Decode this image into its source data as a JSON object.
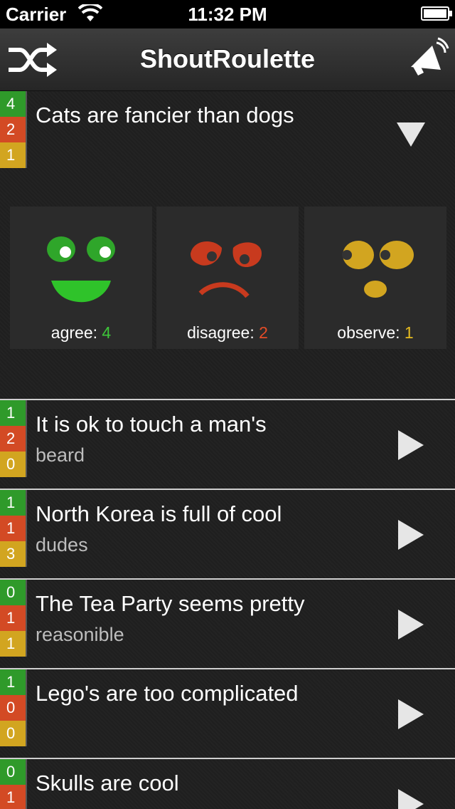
{
  "status_bar": {
    "carrier": "Carrier",
    "time": "11:32 PM"
  },
  "nav": {
    "title": "ShoutRoulette",
    "left_icon": "shuffle-icon",
    "right_icon": "megaphone-icon"
  },
  "expanded_shout": {
    "scores": [
      "4",
      "2",
      "1"
    ],
    "title": "Cats are fancier than dogs",
    "votes": [
      {
        "label": "agree:",
        "count": "4",
        "color": "#3ec53a"
      },
      {
        "label": "disagree:",
        "count": "2",
        "color": "#e44c27"
      },
      {
        "label": "observe:",
        "count": "1",
        "color": "#e6bb20"
      }
    ]
  },
  "shouts": [
    {
      "scores": [
        "1",
        "2",
        "0"
      ],
      "line1": "It is ok to touch a man's",
      "line2": "beard"
    },
    {
      "scores": [
        "1",
        "1",
        "3"
      ],
      "line1": "North Korea is full of cool",
      "line2": "dudes"
    },
    {
      "scores": [
        "0",
        "1",
        "1"
      ],
      "line1": "The Tea Party seems pretty",
      "line2": "reasonible"
    },
    {
      "scores": [
        "1",
        "0",
        "0"
      ],
      "line1": "Lego's are too complicated",
      "line2": ""
    },
    {
      "scores": [
        "0",
        "1",
        ""
      ],
      "line1": "Skulls are cool",
      "line2": ""
    }
  ],
  "colors": {
    "agree": "#2f9a2a",
    "disagree": "#d34a24",
    "observe": "#d2a520"
  }
}
